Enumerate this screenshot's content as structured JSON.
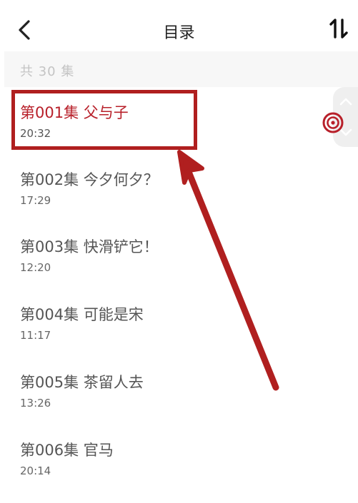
{
  "header": {
    "title": "目录",
    "back_icon": "chevron-left-icon",
    "sort_icon": "sort-toggle-icon"
  },
  "summary": {
    "count_text": "共 30 集"
  },
  "episodes": [
    {
      "title": "第001集 父与子",
      "duration": "20:32",
      "active": true
    },
    {
      "title": "第002集 今夕何夕？",
      "duration": "17:29",
      "active": false
    },
    {
      "title": "第003集 快滑铲它！",
      "duration": "12:20",
      "active": false
    },
    {
      "title": "第004集 可能是宋",
      "duration": "11:17",
      "active": false
    },
    {
      "title": "第005集 茶留人去",
      "duration": "13:26",
      "active": false
    },
    {
      "title": "第006集 官马",
      "duration": "20:14",
      "active": false
    }
  ],
  "playing_indicator": {
    "icon": "now-playing-icon"
  },
  "colors": {
    "accent": "#b8202a",
    "annotation": "#b01f1f",
    "muted_text": "#c4c4c4",
    "bar_background": "#f7f7f7"
  }
}
